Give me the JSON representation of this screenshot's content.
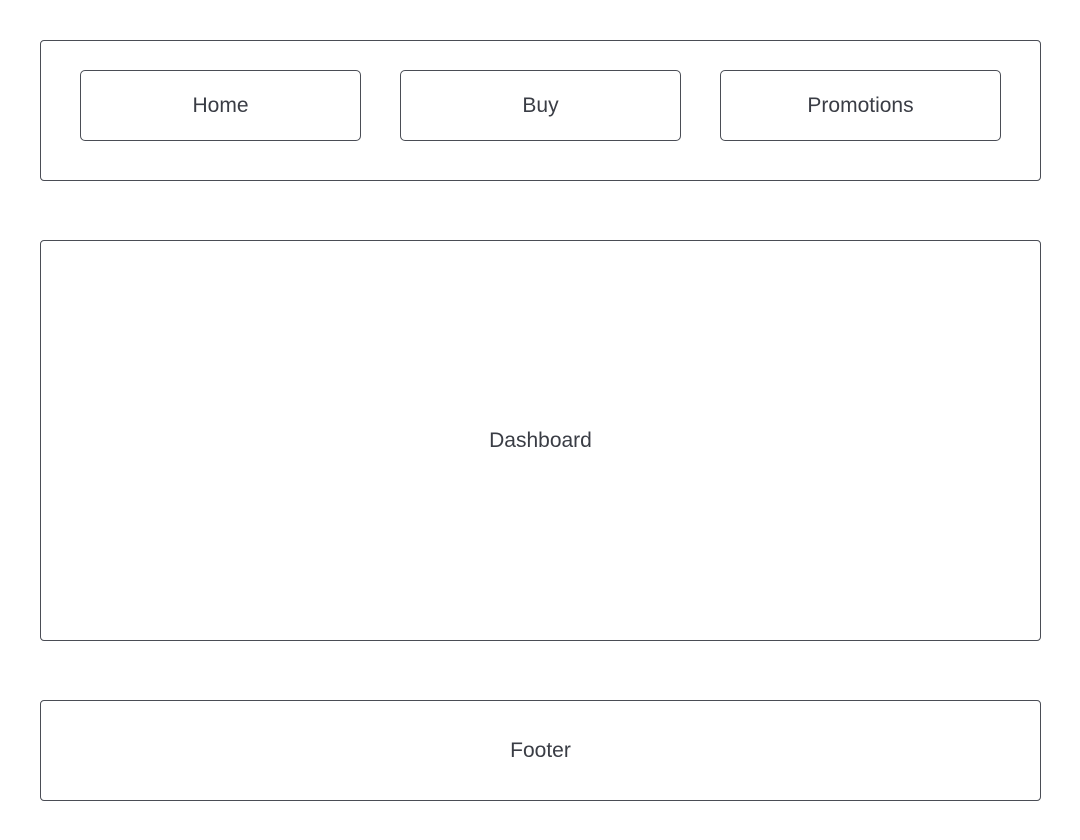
{
  "nav": {
    "items": [
      {
        "label": "Home"
      },
      {
        "label": "Buy"
      },
      {
        "label": "Promotions"
      }
    ]
  },
  "main": {
    "dashboard_label": "Dashboard"
  },
  "footer": {
    "label": "Footer"
  },
  "colors": {
    "border": "#4a4d55",
    "text": "#3a3d45",
    "background": "#ffffff"
  }
}
